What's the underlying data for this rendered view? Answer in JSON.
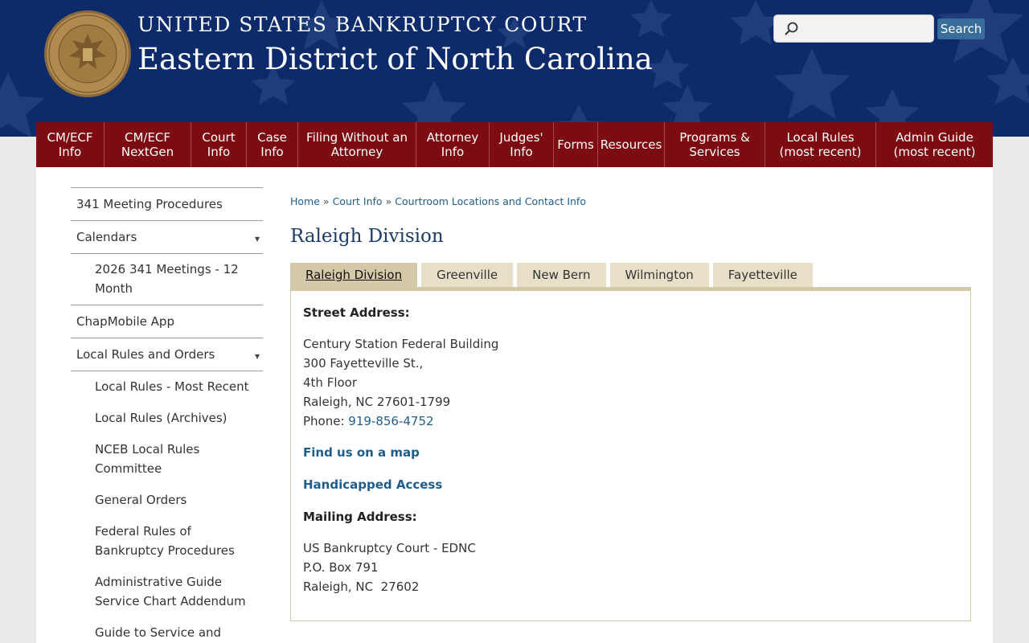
{
  "header": {
    "court_name": "UNITED STATES BANKRUPTCY COURT",
    "district_name": "Eastern District of North Carolina",
    "search_placeholder": "",
    "search_button": "Search"
  },
  "nav": {
    "items": [
      {
        "label": "CM/ECF Info"
      },
      {
        "label": "CM/ECF NextGen"
      },
      {
        "label": "Court Info"
      },
      {
        "label": "Case Info"
      },
      {
        "label": "Filing Without an Attorney"
      },
      {
        "label": "Attorney Info"
      },
      {
        "label": "Judges' Info"
      },
      {
        "label": "Forms"
      },
      {
        "label": "Resources"
      },
      {
        "label": "Programs & Services"
      },
      {
        "label": "Local Rules (most recent)"
      },
      {
        "label": "Admin Guide (most recent)"
      }
    ]
  },
  "sidebar": {
    "items": [
      {
        "label": "341 Meeting Procedures"
      },
      {
        "label": "Calendars"
      },
      {
        "label": "2026 341 Meetings - 12 Month"
      },
      {
        "label": "ChapMobile App"
      },
      {
        "label": "Local Rules and Orders"
      },
      {
        "label": "Local Rules - Most Recent"
      },
      {
        "label": "Local Rules (Archives)"
      },
      {
        "label": "NCEB Local Rules Committee"
      },
      {
        "label": "General Orders"
      },
      {
        "label": "Federal Rules of Bankruptcy Procedures"
      },
      {
        "label": "Administrative Guide Service Chart Addendum"
      },
      {
        "label": "Guide to Service and Notice"
      }
    ]
  },
  "breadcrumb": {
    "items": [
      "Home",
      "Court Info",
      "Courtroom Locations and Contact Info"
    ],
    "separator": "»"
  },
  "page_title": "Raleigh Division",
  "tabs": [
    {
      "label": "Raleigh Division",
      "active": true
    },
    {
      "label": "Greenville",
      "active": false
    },
    {
      "label": "New Bern",
      "active": false
    },
    {
      "label": "Wilmington",
      "active": false
    },
    {
      "label": "Fayetteville",
      "active": false
    }
  ],
  "panel": {
    "street_label": "Street Address:",
    "street_lines": [
      "Century Station Federal Building",
      "300 Fayetteville St.,",
      "4th Floor",
      "Raleigh, NC 27601-1799"
    ],
    "phone_label": "Phone: ",
    "phone_number": "919-856-4752",
    "map_link": "Find us on a map",
    "access_link": "Handicapped Access",
    "mailing_label": "Mailing Address:",
    "mailing_lines": [
      "US Bankruptcy Court - EDNC",
      "P.O. Box 791",
      "Raleigh, NC  27602"
    ]
  },
  "colors": {
    "header_bg": "#0d2b6b",
    "nav_bg": "#7c0c11",
    "tab_bg": "#e7dfc7",
    "tab_active_bg": "#d4c9a6",
    "link": "#1f5d8a"
  },
  "icons": {
    "seal": "court-seal",
    "search": "magnifier-icon",
    "dropdown": "caret-down-icon"
  }
}
